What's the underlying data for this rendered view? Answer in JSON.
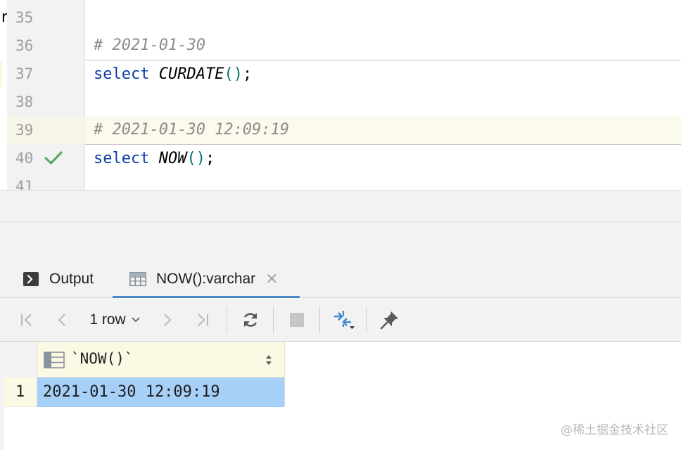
{
  "editor": {
    "left_clip_char": "r",
    "lines": [
      {
        "no": "35",
        "segments": []
      },
      {
        "no": "36",
        "segments": [
          {
            "cls": "cmt",
            "text": "# 2021-01-30"
          }
        ]
      },
      {
        "no": "37",
        "segments": [
          {
            "cls": "kw",
            "text": "select"
          },
          {
            "cls": "semi",
            "text": " "
          },
          {
            "cls": "fn",
            "text": "CURDATE"
          },
          {
            "cls": "paren",
            "text": "()"
          },
          {
            "cls": "semi",
            "text": ";"
          }
        ]
      },
      {
        "no": "38",
        "segments": []
      },
      {
        "no": "39",
        "segments": [
          {
            "cls": "cmt",
            "text": "# 2021-01-30 12:09:19"
          }
        ]
      },
      {
        "no": "40",
        "segments": [
          {
            "cls": "kw",
            "text": "select"
          },
          {
            "cls": "semi",
            "text": " "
          },
          {
            "cls": "fn",
            "text": "NOW"
          },
          {
            "cls": "paren",
            "text": "()"
          },
          {
            "cls": "semi",
            "text": ";"
          }
        ]
      },
      {
        "no": "41",
        "segments": []
      }
    ]
  },
  "tabs": {
    "output_label": "Output",
    "result_label": "NOW():varchar",
    "close_icon": "close-icon"
  },
  "toolbar": {
    "row_count": "1 row"
  },
  "result_grid": {
    "column": "`NOW()`",
    "rows": [
      {
        "num": "1",
        "value": "2021-01-30 12:09:19"
      }
    ]
  },
  "watermark": "@稀土掘金技术社区",
  "colors": {
    "keyword": "#0b3ea8",
    "comment": "#8c8c8c",
    "paren": "#00726f",
    "check": "#59a869",
    "selection": "#a7d0f8",
    "active_tab": "#4a88c7"
  }
}
